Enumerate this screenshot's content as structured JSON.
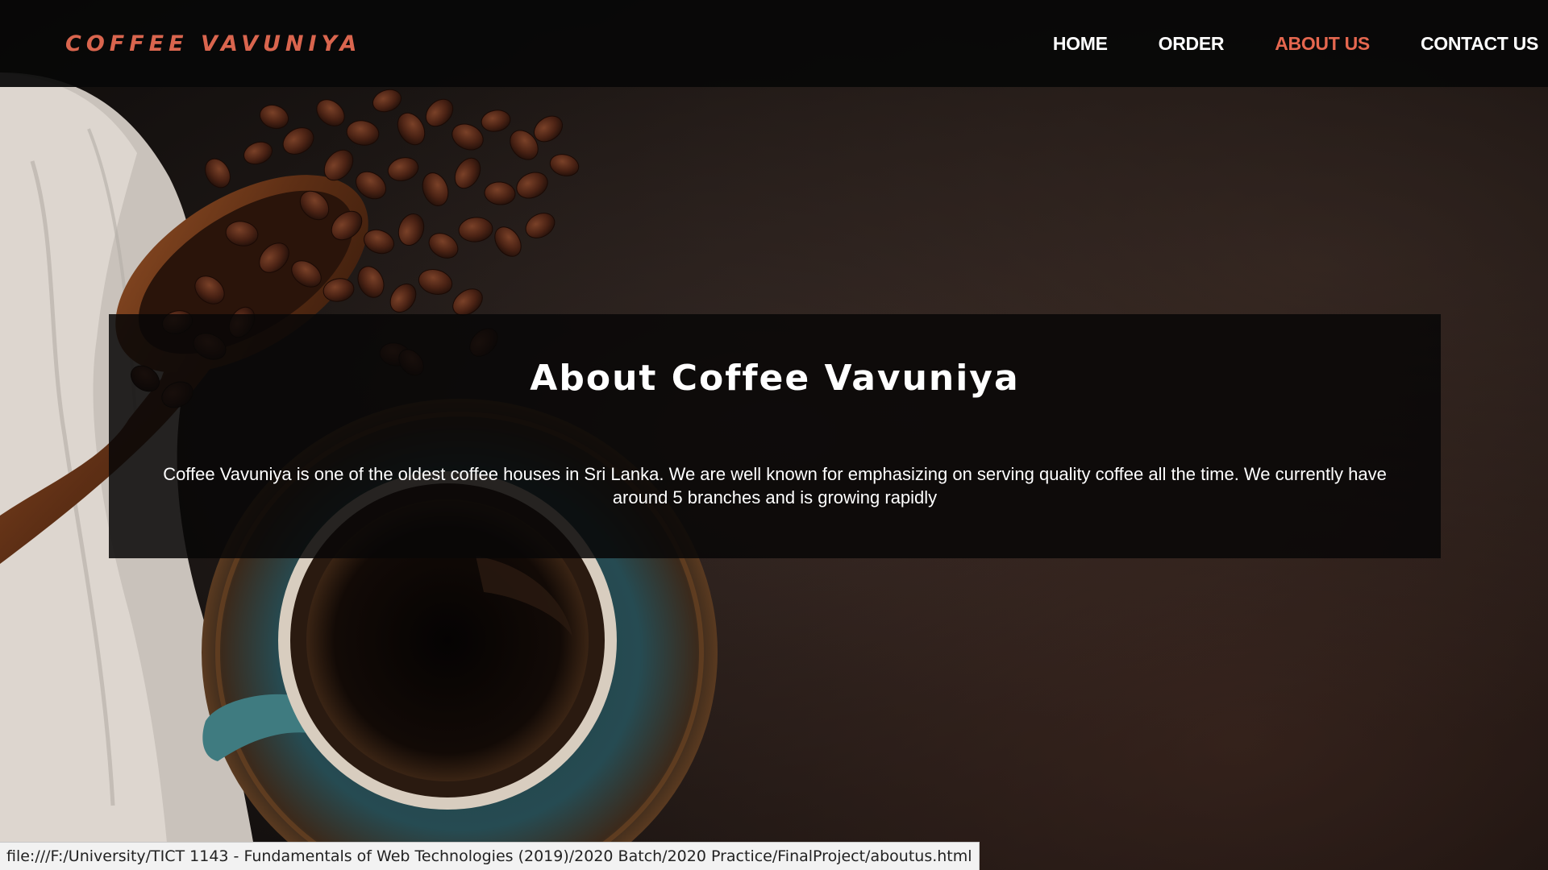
{
  "brand": {
    "name": "COFFEE VAVUNIYA"
  },
  "nav": {
    "items": [
      {
        "label": "HOME",
        "active": false
      },
      {
        "label": "ORDER",
        "active": false
      },
      {
        "label": "ABOUT US",
        "active": true
      },
      {
        "label": "CONTACT US",
        "active": false
      }
    ]
  },
  "about": {
    "title": "About Coffee Vavuniya",
    "body": "Coffee Vavuniya is one of the oldest coffee houses in Sri Lanka. We are well known for emphasizing on serving quality coffee all the time. We currently have around 5 branches and is growing rapidly"
  },
  "status_bar": {
    "url": "file:///F:/University/TICT 1143 - Fundamentals of Web Technologies (2019)/2020 Batch/2020 Practice/FinalProject/aboutus.html"
  },
  "colors": {
    "accent": "#e5674f",
    "brand": "#d9654e",
    "navbar_bg": "#080808",
    "background": "#1a1513"
  },
  "background_image": {
    "subject": "coffee-beans-scoop-cup-napkin"
  }
}
